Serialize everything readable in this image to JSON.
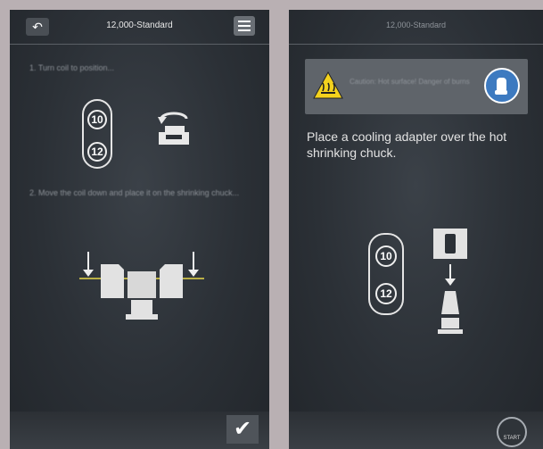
{
  "left_panel": {
    "title": "12,000-Standard",
    "back_icon": "undo-arrow-icon",
    "menu_icon": "hamburger-menu-icon",
    "step1": "1. Turn coil to position...",
    "step2": "2. Move the coil down and place it on the shrinking chuck...",
    "sizes": [
      "10",
      "12"
    ],
    "confirm_icon": "checkmark-icon"
  },
  "right_panel": {
    "title": "12,000-Standard",
    "warning_text": "Caution: Hot surface! Danger of burns",
    "instruction": "Place a cooling adapter over the hot shrinking chuck.",
    "sizes": [
      "10",
      "12"
    ],
    "start_label": "START",
    "warning_icon": "hot-surface-warning-icon",
    "info_icon": "glove-info-icon"
  },
  "colors": {
    "panel_bg": "#2b3036",
    "warning_yellow": "#f4d21d",
    "info_blue": "#3d7ac0",
    "accent_yellow_line": "#e8d84a"
  }
}
